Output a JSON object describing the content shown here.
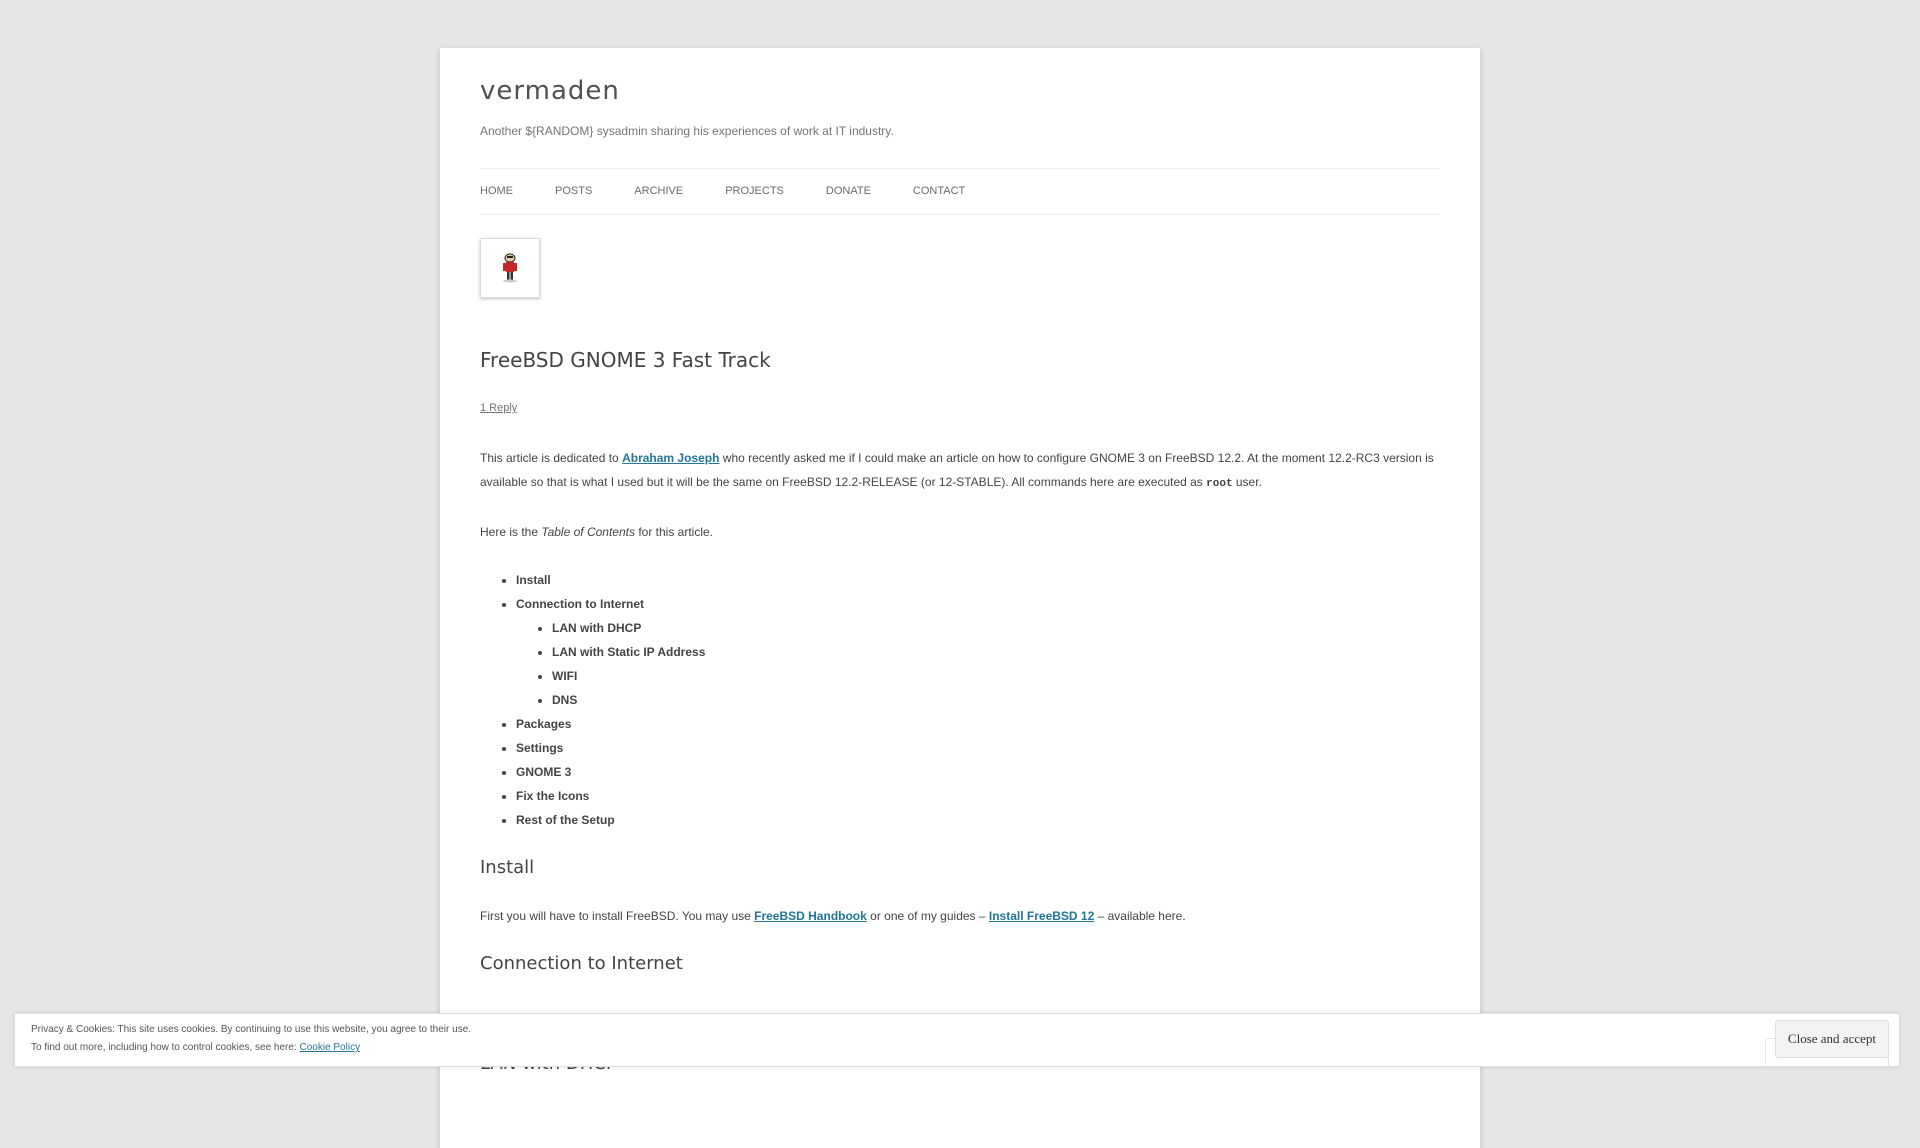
{
  "site": {
    "title": "vermaden",
    "description": "Another ${RANDOM} sysadmin sharing his experiences of work at IT industry."
  },
  "nav": [
    "HOME",
    "POSTS",
    "ARCHIVE",
    "PROJECTS",
    "DONATE",
    "CONTACT"
  ],
  "post": {
    "title": "FreeBSD GNOME 3 Fast Track",
    "reply": "1 Reply",
    "intro": {
      "a": "This article is dedicated to ",
      "link": "Abraham Joseph",
      "b": " who recently asked me if I could make an article on how to configure GNOME 3 on FreeBSD 12.2. At the moment 12.2-RC3 version is available so that is what I used but it will be the same on FreeBSD 12.2-RELEASE (or 12-STABLE). All commands here are executed as ",
      "code": "root",
      "c": " user."
    },
    "toc_intro": {
      "a": "Here is the ",
      "em": "Table of Contents",
      "b": " for this article."
    },
    "toc": [
      "Install",
      "Connection to Internet",
      "LAN with DHCP",
      "LAN with Static IP Address",
      "WIFI",
      "DNS",
      "Packages",
      "Settings",
      "GNOME 3",
      "Fix the Icons",
      "Rest of the Setup"
    ],
    "install_heading": "Install",
    "install_text": {
      "a": "First you will have to install FreeBSD. You may use ",
      "link1": "FreeBSD Handbook",
      "b": " or one of my guides – ",
      "link2": "Install FreeBSD 12",
      "c": " – available here."
    },
    "connection_heading": "Connection to Internet",
    "lan_heading": "LAN with DHCP"
  },
  "cookie": {
    "line1": "Privacy & Cookies: This site uses cookies. By continuing to use this website, you agree to their use.",
    "line2": "To find out more, including how to control cookies, see here: ",
    "policy": "Cookie Policy",
    "button": "Close and accept"
  }
}
